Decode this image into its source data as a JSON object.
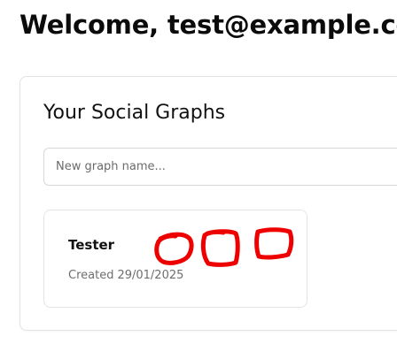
{
  "header": {
    "welcome": "Welcome, test@example.co"
  },
  "graphs_panel": {
    "title": "Your Social Graphs",
    "new_graph_input": {
      "placeholder": "New graph name...",
      "value": ""
    },
    "graphs": [
      {
        "name": "Tester",
        "created_label": "Created",
        "created_date": "29/01/2025"
      }
    ]
  },
  "annotations": {
    "color": "#ee0000",
    "mark_count": 3
  }
}
